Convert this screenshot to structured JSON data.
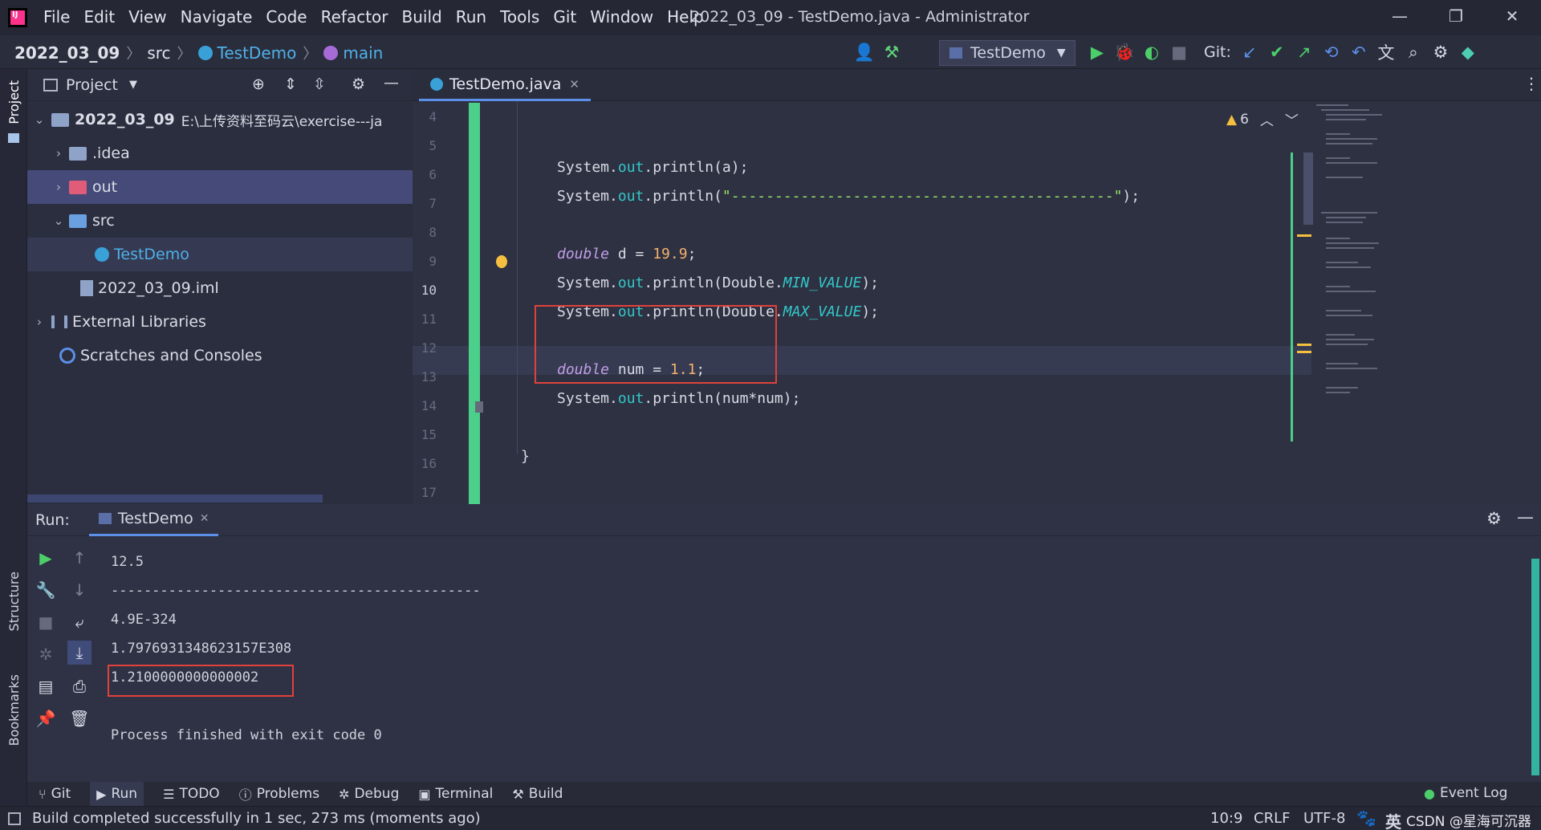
{
  "window": {
    "title": "2022_03_09 - TestDemo.java - Administrator",
    "menu": [
      "File",
      "Edit",
      "View",
      "Navigate",
      "Code",
      "Refactor",
      "Build",
      "Run",
      "Tools",
      "Git",
      "Window",
      "Help"
    ]
  },
  "breadcrumb": {
    "project": "2022_03_09",
    "folder": "src",
    "class": "TestDemo",
    "method": "main"
  },
  "toolbar": {
    "run_config": "TestDemo",
    "git_label": "Git:"
  },
  "left_stripe": {
    "project_label": "Project",
    "structure_label": "Structure",
    "bookmarks_label": "Bookmarks"
  },
  "project_panel": {
    "title": "Project",
    "root_name": "2022_03_09",
    "root_path": "E:\\上传资料至码云\\exercise---java-cc",
    "items": [
      "idea",
      "out",
      "src",
      "TestDemo",
      "2022_03_09.iml",
      "External Libraries",
      "Scratches and Consoles"
    ],
    "idea_label": ".idea"
  },
  "editor": {
    "tab_label": "TestDemo.java",
    "warnings": "6",
    "line_numbers": [
      "4",
      "5",
      "6",
      "7",
      "8",
      "9",
      "10",
      "11",
      "12",
      "13",
      "14",
      "15",
      "16",
      "17"
    ],
    "lines": {
      "l4_obj": "System.",
      "l4_out": "out",
      "l4_rest": ".println(a);",
      "l5_obj": "System.",
      "l5_out": "out",
      "l5_call": ".println(",
      "l5_str": "\"--------------------------------------------\"",
      "l5_end": ");",
      "l7_kw": "double",
      "l7_var": " d = ",
      "l7_num": "19.9",
      "l7_end": ";",
      "l8_obj": "System.",
      "l8_out": "out",
      "l8_call": ".println(Double.",
      "l8_field": "MIN_VALUE",
      "l8_end": ");",
      "l9_obj": "System.",
      "l9_out": "out",
      "l9_call": ".println(Double.",
      "l9_field": "MAX_VALUE",
      "l9_end": ");",
      "l11_kw": "double",
      "l11_var": " num = ",
      "l11_num": "1.1",
      "l11_end": ";",
      "l12_obj": "System.",
      "l12_out": "out",
      "l12_rest": ".println(num*num);",
      "l14": "}"
    }
  },
  "run_panel": {
    "label": "Run:",
    "tab_label": "TestDemo",
    "output": [
      "12.5",
      "---------------------------------------------",
      "4.9E-324",
      "1.7976931348623157E308",
      "1.2100000000000002",
      "",
      "Process finished with exit code 0"
    ]
  },
  "tool_tabs": [
    "Git",
    "Run",
    "TODO",
    "Problems",
    "Debug",
    "Terminal",
    "Build"
  ],
  "event_log": "Event Log",
  "status": {
    "message": "Build completed successfully in 1 sec, 273 ms (moments ago)",
    "position": "10:9",
    "line_sep": "CRLF",
    "encoding": "UTF-8",
    "ime": "英",
    "watermark": "CSDN @星海可沉器"
  },
  "colors": {
    "accent": "#5c8fe8",
    "highlight": "#e1413b",
    "change_bar": "#4ccf8a",
    "selected_row": "#454a78"
  }
}
